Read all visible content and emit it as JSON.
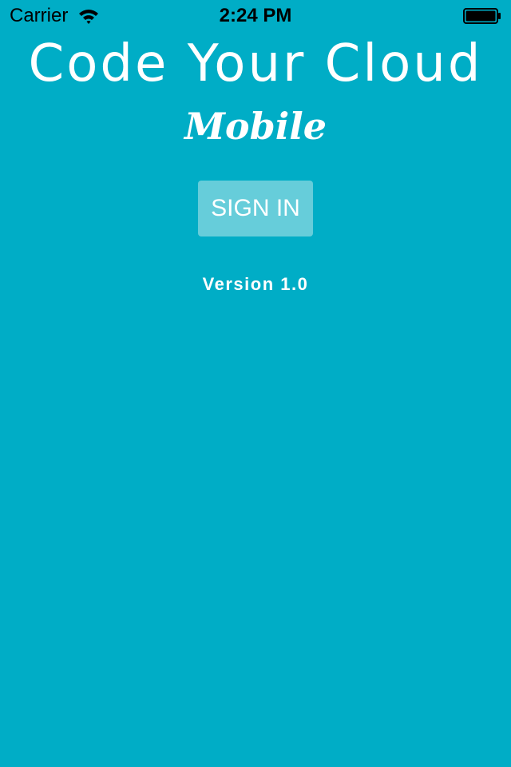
{
  "status_bar": {
    "carrier": "Carrier",
    "time": "2:24 PM",
    "icons": [
      "wifi-icon",
      "battery-icon"
    ]
  },
  "app": {
    "title": "Code Your Cloud",
    "subtitle": "Mobile",
    "sign_in_label": "SIGN IN",
    "version": "Version 1.0"
  },
  "colors": {
    "background": "#00adc6",
    "button_background": "#66cdda",
    "text": "#ffffff"
  }
}
